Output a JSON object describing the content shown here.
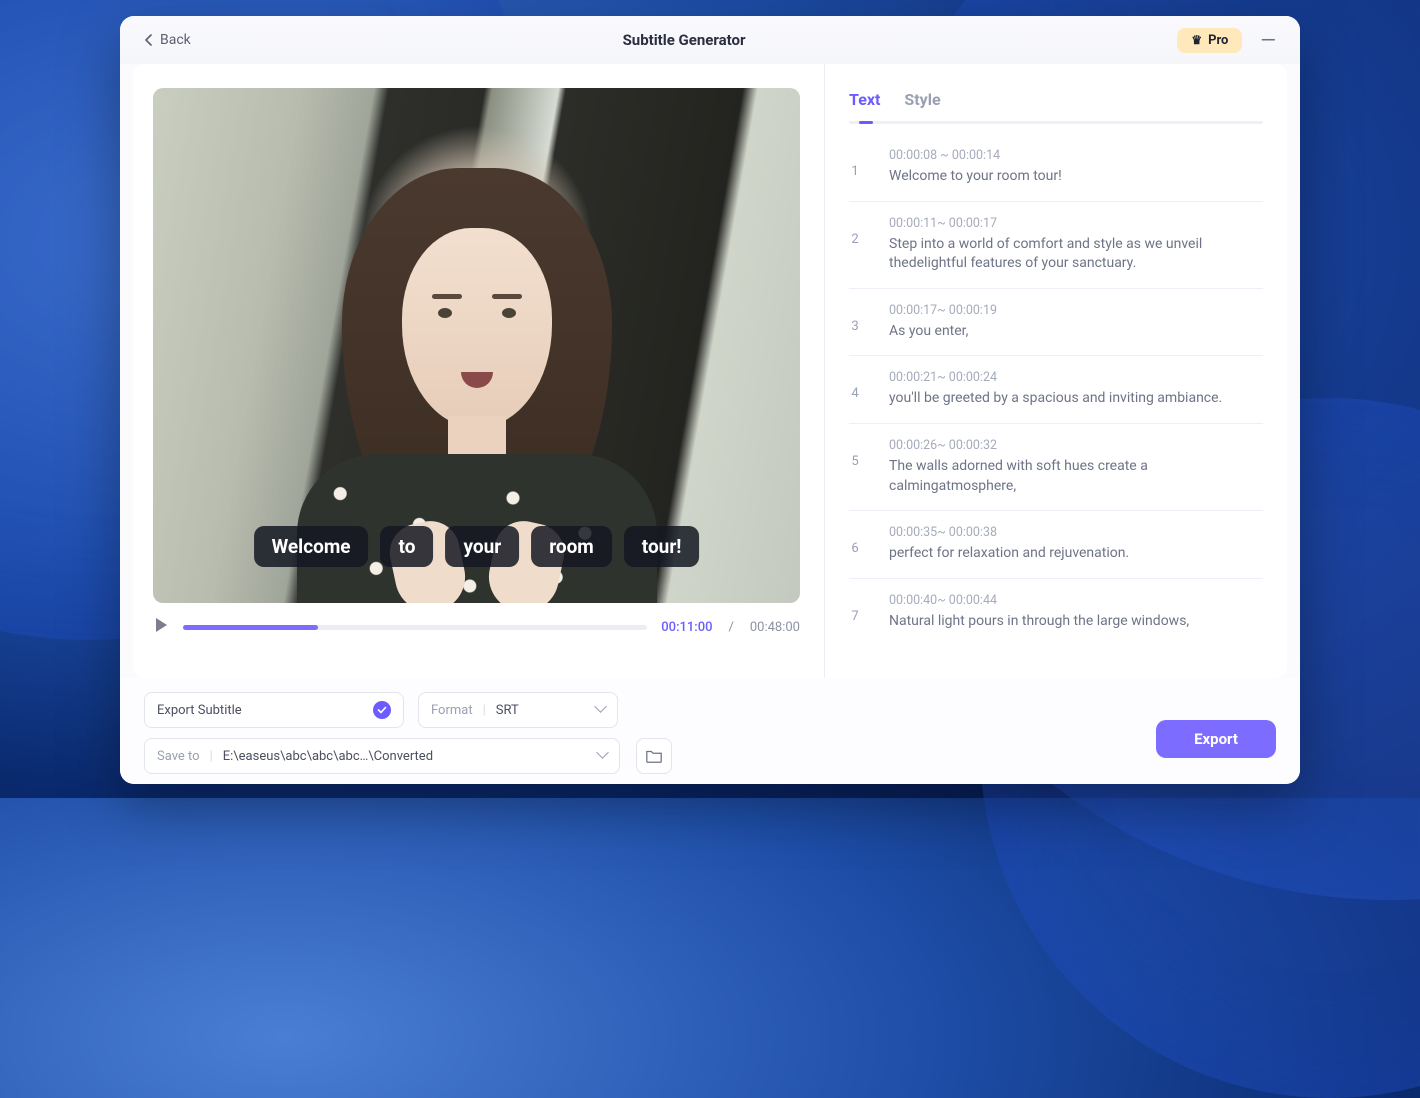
{
  "header": {
    "back_label": "Back",
    "title": "Subtitle Generator",
    "pro_label": "Pro"
  },
  "player": {
    "overlay_words": [
      "Welcome",
      "to",
      "your",
      "room",
      "tour!"
    ],
    "current_time": "00:11:00",
    "total_time": "00:48:00",
    "progress_percent": 29
  },
  "tabs": {
    "text": "Text",
    "style": "Style",
    "active": "text"
  },
  "subtitles": [
    {
      "idx": "1",
      "time": "00:00:08 ~ 00:00:14",
      "text": "Welcome to your room tour!"
    },
    {
      "idx": "2",
      "time": "00:00:11~ 00:00:17",
      "text": "Step into a world of comfort and style as we unveil thedelightful features of your sanctuary."
    },
    {
      "idx": "3",
      "time": "00:00:17~ 00:00:19",
      "text": "As you enter,"
    },
    {
      "idx": "4",
      "time": "00:00:21~ 00:00:24",
      "text": "you'll be greeted by a spacious and inviting ambiance."
    },
    {
      "idx": "5",
      "time": "00:00:26~ 00:00:32",
      "text": "The walls adorned with soft hues create a calmingatmosphere,"
    },
    {
      "idx": "6",
      "time": "00:00:35~ 00:00:38",
      "text": "perfect for relaxation and rejuvenation."
    },
    {
      "idx": "7",
      "time": "00:00:40~ 00:00:44",
      "text": "Natural light pours in through the large windows,"
    }
  ],
  "footer": {
    "export_subtitle_label": "Export Subtitle",
    "format_label": "Format",
    "format_value": "SRT",
    "saveto_label": "Save to",
    "saveto_value": "E:\\easeus\\abc\\abc\\abc…\\Converted",
    "export_button": "Export"
  }
}
